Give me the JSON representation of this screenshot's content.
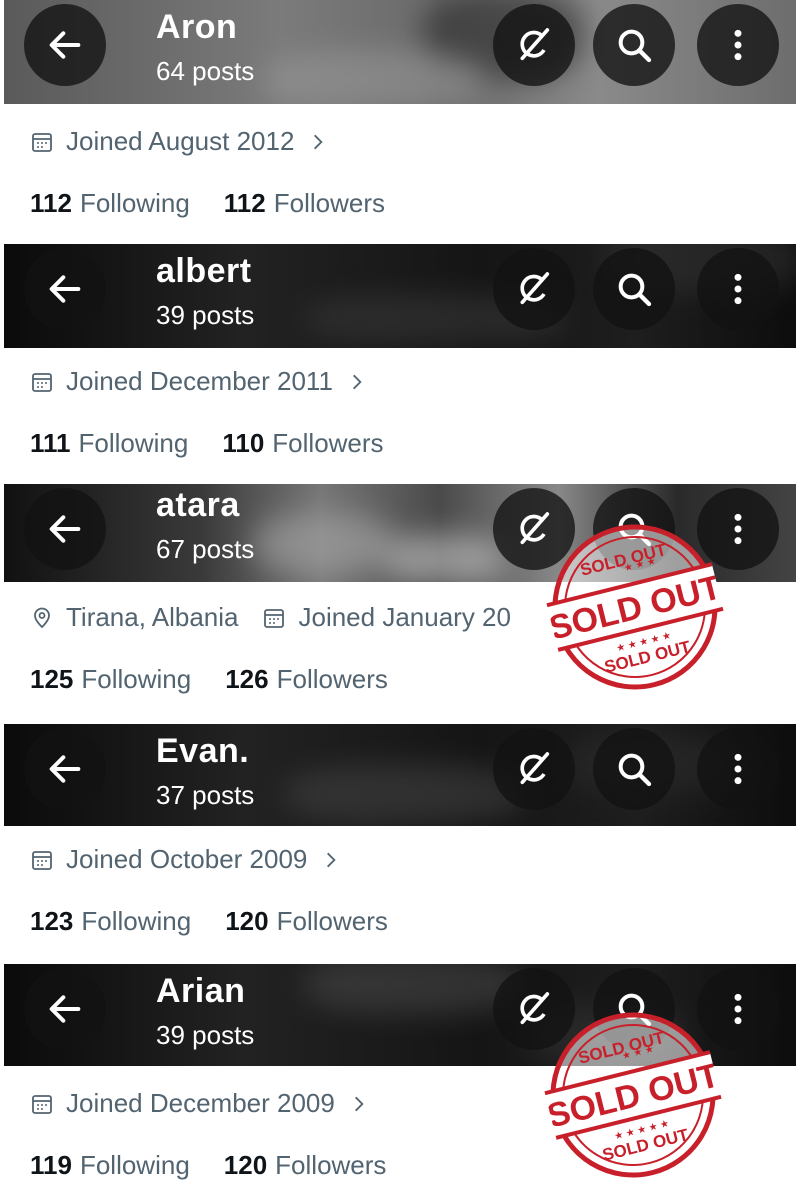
{
  "colors": {
    "muted_text": "#536471",
    "primary_text": "#0f1419",
    "stamp_red": "#c8202b"
  },
  "icons": {
    "back": "back-arrow-icon",
    "grok": "grok-icon",
    "search": "search-icon",
    "more": "more-vertical-icon",
    "calendar": "calendar-icon",
    "location": "location-pin-icon",
    "chevron": "chevron-right-icon"
  },
  "stamp": {
    "main": "SOLD OUT",
    "top": "SOLD OUT",
    "bottom": "SOLD OUT"
  },
  "profiles": [
    {
      "name": "Aron",
      "posts": "64 posts",
      "joined": "Joined August 2012",
      "following_count": "112",
      "following_label": "Following",
      "followers_count": "112",
      "followers_label": "Followers"
    },
    {
      "name": "albert",
      "posts": "39 posts",
      "joined": "Joined December 2011",
      "following_count": "111",
      "following_label": "Following",
      "followers_count": "110",
      "followers_label": "Followers"
    },
    {
      "name": "atara",
      "posts": "67 posts",
      "location": "Tirana, Albania",
      "joined": "Joined January 20",
      "following_count": "125",
      "following_label": "Following",
      "followers_count": "126",
      "followers_label": "Followers",
      "sold_out": true
    },
    {
      "name": "Evan.",
      "posts": "37 posts",
      "joined": "Joined October 2009",
      "following_count": "123",
      "following_label": "Following",
      "followers_count": "120",
      "followers_label": "Followers"
    },
    {
      "name": "Arian",
      "posts": "39 posts",
      "joined": "Joined December 2009",
      "following_count": "119",
      "following_label": "Following",
      "followers_count": "120",
      "followers_label": "Followers",
      "sold_out": true
    }
  ]
}
